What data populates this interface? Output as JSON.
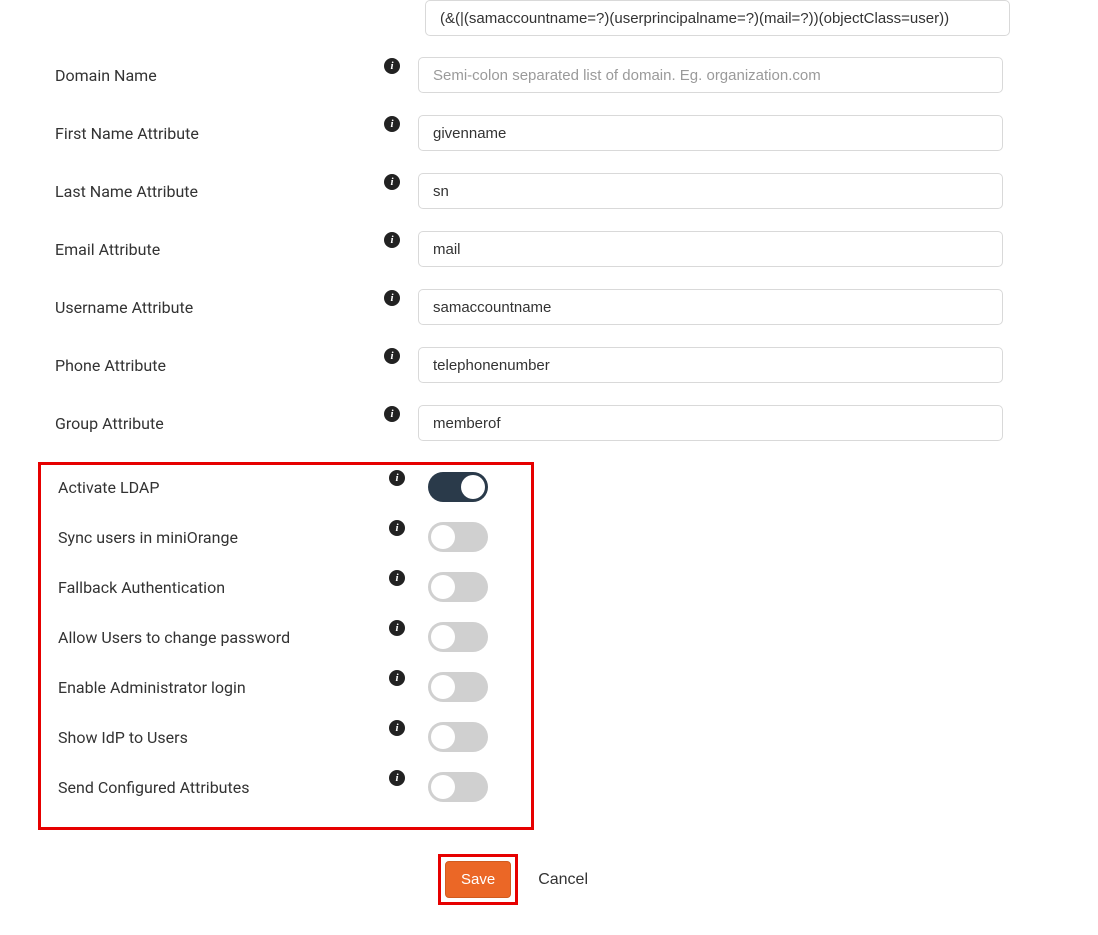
{
  "fields": {
    "search_filter": {
      "value": "(&(|(samaccountname=?)(userprincipalname=?)(mail=?))(objectClass=user))"
    },
    "domain_name": {
      "label": "Domain Name",
      "placeholder": "Semi-colon separated list of domain. Eg. organization.com",
      "value": ""
    },
    "first_name_attr": {
      "label": "First Name Attribute",
      "value": "givenname"
    },
    "last_name_attr": {
      "label": "Last Name Attribute",
      "value": "sn"
    },
    "email_attr": {
      "label": "Email Attribute",
      "value": "mail"
    },
    "username_attr": {
      "label": "Username Attribute",
      "value": "samaccountname"
    },
    "phone_attr": {
      "label": "Phone Attribute",
      "value": "telephonenumber"
    },
    "group_attr": {
      "label": "Group Attribute",
      "value": "memberof"
    }
  },
  "toggles": {
    "activate_ldap": {
      "label": "Activate LDAP",
      "on": true
    },
    "sync_users": {
      "label": "Sync users in miniOrange",
      "on": false
    },
    "fallback_auth": {
      "label": "Fallback Authentication",
      "on": false
    },
    "allow_change_pwd": {
      "label": "Allow Users to change password",
      "on": false
    },
    "admin_login": {
      "label": "Enable Administrator login",
      "on": false
    },
    "show_idp": {
      "label": "Show IdP to Users",
      "on": false
    },
    "send_attrs": {
      "label": "Send Configured Attributes",
      "on": false
    }
  },
  "buttons": {
    "save": "Save",
    "cancel": "Cancel"
  }
}
